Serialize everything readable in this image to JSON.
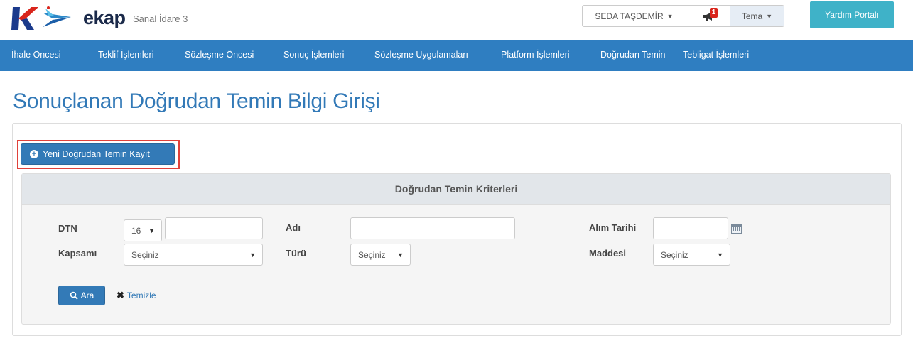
{
  "header": {
    "brand": "ekap",
    "subbrand": "Sanal İdare 3",
    "user_name": "SEDA TAŞDEMİR",
    "notification_count": "1",
    "theme_label": "Tema",
    "help_label": "Yardım Portalı"
  },
  "nav": {
    "items": [
      "İhale Öncesi",
      "Teklif İşlemleri",
      "Sözleşme Öncesi",
      "Sonuç İşlemleri",
      "Sözleşme Uygulamaları",
      "Platform İşlemleri",
      "Doğrudan Temin",
      "Tebligat İşlemleri"
    ]
  },
  "page": {
    "title": "Sonuçlanan Doğrudan Temin Bilgi Girişi",
    "new_record_label": "Yeni Doğrudan Temin Kayıt"
  },
  "criteria": {
    "title": "Doğrudan Temin Kriterleri",
    "dtn_label": "DTN",
    "dtn_year": "16",
    "dtn_value": "",
    "adi_label": "Adı",
    "adi_value": "",
    "alim_tarihi_label": "Alım Tarihi",
    "alim_tarihi_value": "",
    "kapsami_label": "Kapsamı",
    "kapsami_value": "Seçiniz",
    "turu_label": "Türü",
    "turu_value": "Seçiniz",
    "maddesi_label": "Maddesi",
    "maddesi_value": "Seçiniz",
    "search_label": "Ara",
    "clear_label": "Temizle"
  },
  "colors": {
    "nav_bg": "#2f7ec1",
    "primary": "#337ab7",
    "help_bg": "#3fb2c8",
    "highlight": "#e0413a"
  }
}
